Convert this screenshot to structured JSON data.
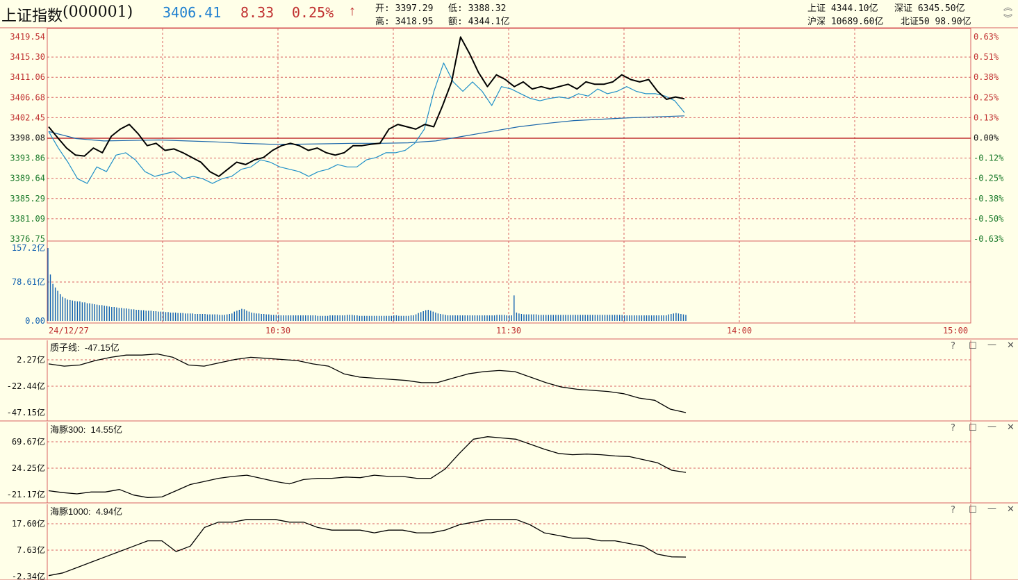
{
  "header": {
    "title": "上证指数",
    "code": "(000001)",
    "price": "3406.41",
    "change": "8.33",
    "change_pct": "0.25%",
    "open_label": "开:",
    "open": "3397.29",
    "low_label": "低:",
    "low": "3388.32",
    "high_label": "高:",
    "high": "3418.95",
    "amount_label": "额:",
    "amount": "4344.1亿",
    "markets": [
      {
        "label": "上证",
        "value": "4344.10亿"
      },
      {
        "label": "深证",
        "value": "6345.50亿"
      },
      {
        "label": "沪深",
        "value": "10689.60亿"
      },
      {
        "label": "北证50",
        "value": "98.90亿"
      }
    ]
  },
  "colors": {
    "up": "#c03030",
    "price_line": "#000000",
    "avg_line": "#1a66aa",
    "blue": "#1e8fc8",
    "vol": "#1060b0",
    "grid": "#d96060",
    "bg": "#ffffe8"
  },
  "chart_data": [
    {
      "type": "line",
      "name": "intraday",
      "y_ticks": [
        "3419.54",
        "3415.30",
        "3411.06",
        "3406.68",
        "3402.45",
        "3398.08",
        "3393.86",
        "3389.64",
        "3385.29",
        "3381.09",
        "3376.75"
      ],
      "pct_ticks": [
        "0.63%",
        "0.51%",
        "0.38%",
        "0.25%",
        "0.13%",
        "0.00%",
        "-0.12%",
        "-0.25%",
        "-0.38%",
        "-0.50%",
        "-0.63%"
      ],
      "ylim": [
        3376.75,
        3419.54
      ],
      "prev_close": 3398.08,
      "x_labels": [
        "24/12/27",
        "10:30",
        "11:30",
        "14:00",
        "15:00"
      ],
      "series": [
        {
          "values": [
            3400.5,
            3398.2,
            3396.0,
            3394.5,
            3394.3,
            3396.0,
            3395.0,
            3398.5,
            3400.0,
            3401.0,
            3399.0,
            3396.5,
            3397.0,
            3395.5,
            3395.8,
            3395.0,
            3394.0,
            3393.0,
            3391.0,
            3390.0,
            3391.5,
            3393.0,
            3392.5,
            3393.5,
            3394.0,
            3395.5,
            3396.5,
            3397.0,
            3396.5,
            3395.5,
            3396.0,
            3395.0,
            3394.5,
            3395.0,
            3396.5,
            3396.5,
            3396.8,
            3397.0,
            3400.0,
            3401.0,
            3400.5,
            3400.0,
            3401.0,
            3400.5,
            3405.0,
            3410.0,
            3419.5,
            3416.0,
            3412.0,
            3409.0,
            3411.5,
            3410.5,
            3409.0,
            3410.0,
            3408.5,
            3409.0,
            3408.5,
            3409.0,
            3409.5,
            3408.5,
            3410.0,
            3409.5,
            3409.5,
            3410.0,
            3411.5,
            3410.5,
            3410.0,
            3410.5,
            3408.0,
            3406.3,
            3406.8,
            3406.41
          ]
        },
        {
          "values": [
            3399.5,
            3396.0,
            3393.0,
            3389.5,
            3388.5,
            3392.0,
            3391.0,
            3394.5,
            3395.0,
            3393.5,
            3391.0,
            3390.0,
            3390.5,
            3391.0,
            3389.5,
            3390.0,
            3389.5,
            3388.5,
            3389.5,
            3390.0,
            3391.5,
            3392.0,
            3393.5,
            3393.0,
            3392.0,
            3391.5,
            3391.0,
            3390.0,
            3391.0,
            3391.5,
            3392.5,
            3392.0,
            3392.0,
            3393.5,
            3394.0,
            3395.0,
            3395.0,
            3395.5,
            3397.0,
            3400.0,
            3408.0,
            3414.0,
            3410.0,
            3408.0,
            3410.0,
            3408.0,
            3405.0,
            3409.0,
            3408.5,
            3407.5,
            3406.5,
            3406.0,
            3406.5,
            3406.8,
            3406.5,
            3407.5,
            3407.0,
            3408.5,
            3407.5,
            3408.0,
            3409.0,
            3408.0,
            3407.5,
            3407.5,
            3407.0,
            3406.0,
            3403.5
          ]
        },
        {
          "values": [
            3399.5,
            3398.0,
            3397.5,
            3397.6,
            3397.7,
            3397.5,
            3397.3,
            3397.0,
            3396.8,
            3396.8,
            3396.9,
            3397.0,
            3397.0,
            3397.1,
            3397.5,
            3398.5,
            3399.5,
            3400.5,
            3401.2,
            3401.8,
            3402.1,
            3402.4,
            3402.6,
            3402.8
          ]
        }
      ],
      "volume": {
        "ylim": [
          0,
          157.2
        ],
        "y_ticks": [
          "157.2亿",
          "78.61亿",
          "0.00"
        ],
        "values": [
          157.2,
          100,
          80,
          72,
          65,
          58,
          52,
          49,
          46,
          45,
          44,
          43,
          42,
          42,
          40,
          40,
          38,
          38,
          37,
          36,
          35,
          34,
          34,
          33,
          32,
          31,
          30,
          30,
          29,
          28,
          28,
          27,
          27,
          26,
          25,
          25,
          24,
          24,
          23,
          23,
          22,
          22,
          22,
          21,
          21,
          20,
          20,
          20,
          19,
          19,
          18,
          18,
          18,
          17,
          17,
          17,
          16,
          16,
          16,
          16,
          15,
          15,
          15,
          15,
          15,
          14,
          14,
          14,
          14,
          14,
          13,
          13,
          13,
          14,
          15,
          16,
          20,
          22,
          24,
          26,
          25,
          22,
          20,
          18,
          17,
          16,
          16,
          15,
          15,
          14,
          14,
          13,
          13,
          13,
          13,
          12,
          12,
          12,
          12,
          12,
          12,
          12,
          12,
          12,
          12,
          12,
          12,
          12,
          12,
          12,
          11,
          11,
          11,
          11,
          11,
          12,
          12,
          12,
          12,
          12,
          12,
          12,
          13,
          13,
          13,
          12,
          12,
          11,
          11,
          11,
          11,
          11,
          11,
          11,
          11,
          11,
          11,
          11,
          11,
          11,
          11,
          12,
          12,
          11,
          11,
          11,
          11,
          11,
          12,
          12,
          14,
          17,
          19,
          21,
          23,
          24,
          22,
          20,
          18,
          16,
          15,
          14,
          13,
          12,
          12,
          12,
          12,
          12,
          12,
          12,
          12,
          12,
          12,
          12,
          12,
          12,
          12,
          12,
          12,
          12,
          12,
          12,
          12,
          13,
          13,
          13,
          13,
          12,
          12,
          12,
          55,
          18,
          16,
          15,
          14,
          14,
          14,
          14,
          14,
          14,
          13,
          13,
          13,
          13,
          13,
          13,
          13,
          13,
          13,
          13,
          13,
          13,
          13,
          13,
          13,
          13,
          13,
          13,
          13,
          13,
          13,
          13,
          13,
          13,
          13,
          13,
          13,
          13,
          13,
          13,
          13,
          13,
          13,
          13,
          13,
          12,
          12,
          12,
          12,
          12,
          12,
          12,
          12,
          12,
          12,
          12,
          12,
          12,
          12,
          12,
          12,
          12,
          12,
          14,
          15,
          16,
          17,
          16,
          15,
          14,
          13
        ]
      }
    },
    {
      "type": "line",
      "name": "质子线",
      "label": "质子线:",
      "value": "-47.15亿",
      "y_ticks": [
        "2.27亿",
        "-22.44亿",
        "-47.15亿"
      ],
      "ylim": [
        -47.15,
        7
      ],
      "values": [
        -3,
        -5,
        -4,
        0,
        3,
        5,
        5,
        6,
        3,
        -4,
        -5,
        -2,
        1,
        3,
        2,
        1,
        0,
        -3,
        -5,
        -12,
        -15,
        -16,
        -17,
        -18,
        -20,
        -20,
        -16,
        -12,
        -10,
        -9,
        -10,
        -15,
        -20,
        -24,
        -26,
        -27,
        -28,
        -30,
        -34,
        -36,
        -44,
        -47.15
      ]
    },
    {
      "type": "line",
      "name": "海豚300",
      "label": "海豚300:",
      "value": "14.55亿",
      "y_ticks": [
        "69.67亿",
        "24.25亿",
        "-21.17亿"
      ],
      "ylim": [
        -21.17,
        75
      ],
      "values": [
        -15,
        -18,
        -20,
        -17,
        -17,
        -13,
        -22,
        -26,
        -25,
        -15,
        -5,
        0,
        5,
        8,
        10,
        5,
        0,
        -4,
        3,
        5,
        5,
        7,
        6,
        10,
        8,
        8,
        5,
        5,
        20,
        45,
        68,
        72,
        70,
        68,
        60,
        52,
        45,
        43,
        44,
        43,
        41,
        40,
        35,
        30,
        18,
        14.55
      ]
    },
    {
      "type": "line",
      "name": "海豚1000",
      "label": "海豚1000:",
      "value": "4.94亿",
      "y_ticks": [
        "17.60亿",
        "7.63亿",
        "-2.34亿"
      ],
      "ylim": [
        -2.34,
        20
      ],
      "values": [
        -2,
        -1,
        1,
        3,
        5,
        7,
        9,
        11,
        11,
        7,
        9,
        16,
        18,
        18,
        19,
        19,
        19,
        18,
        18,
        16,
        15,
        15,
        15,
        14,
        15,
        15,
        14,
        14,
        15,
        17,
        18,
        19,
        19,
        19,
        17,
        14,
        13,
        12,
        12,
        11,
        11,
        10,
        9,
        6,
        5,
        4.94
      ]
    }
  ]
}
